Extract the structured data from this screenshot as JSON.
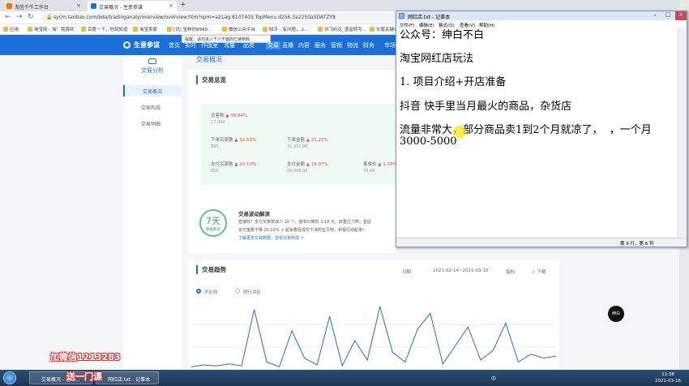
{
  "browser": {
    "tabs": [
      {
        "label": "淘宝千牛工作台"
      },
      {
        "label": "交易概况 - 生意参谋"
      }
    ],
    "new_tab": "+",
    "url": "sycm.taobao.com/bda/tradinganaly/overview/overview.htm?spm=a21ag.8107403.TopMenu.d256.3a2250a5DATZY8",
    "bookmarks": [
      "应用",
      "淘宝网 - 淘！我喜欢",
      "百度一下，你就知道",
      "淘宝卖家",
      "[讯] 宝林你9999...",
      "微信公众平台",
      "知乎 - 有问题，上...",
      "讯飞听见_语音转写...",
      "长尾关键词"
    ]
  },
  "topnav": {
    "brand": "生意参谋",
    "items": [
      "首页",
      "实时",
      "作战室",
      "流量",
      "品类",
      "交易",
      "直播",
      "内容",
      "服务",
      "营销",
      "物流",
      "财务",
      "市场"
    ],
    "active_index": 5,
    "tooltip": "提醒：请勿进入千人千面的已读到我"
  },
  "sidebar": {
    "title": "交易分析",
    "items": [
      "交易概况",
      "交易构成",
      "交易明细"
    ],
    "active_index": 0
  },
  "page_title": "交易概况",
  "overview": {
    "title": "交易总览",
    "metrics": [
      {
        "label": "访客数",
        "change": "38.84%",
        "value": "17,990"
      },
      {
        "label": "下单买家数",
        "change": "32.69%",
        "value": "865"
      },
      {
        "label": "下单金额",
        "change": "21.22%",
        "value": "31,332.06"
      },
      {
        "label": "支付买家数",
        "change": "20.13%",
        "value": "856"
      },
      {
        "label": "支付金额",
        "change": "19.07%",
        "value": "29,008.98"
      },
      {
        "label": "客单价",
        "change": "1.34%",
        "value": "30.40"
      }
    ]
  },
  "diagnosis": {
    "badge_num": "7天",
    "badge_sub": "数据解读",
    "title": "交易波动解读",
    "lines": [
      "直播较！支付买家数减少 10 个，客单价降低 3.18 元，双重压力啊，金店",
      "支付金额下降 20.22% + 起采着看成交下滑的宝贝吧，积极行动起来！",
      "了解更多交易数据，查看交易构成 >"
    ]
  },
  "trend": {
    "title": "交易趋势",
    "period_label": "日期",
    "date_range": "2021-02-14~2021-03-15",
    "indicator_label": "指标",
    "download_label": "下载",
    "radio_1": "不比较",
    "radio_2": "同行对比",
    "line_values": [
      3,
      5,
      4,
      6,
      4,
      62,
      8,
      3,
      40,
      12,
      5,
      55,
      4,
      30,
      10,
      65,
      18,
      8,
      42,
      58,
      6,
      25,
      44,
      10,
      20,
      48,
      8,
      16,
      12,
      14
    ]
  },
  "notepad": {
    "title": "网红店.txt - 记事本",
    "menu": [
      "文件(F)",
      "编辑(E)",
      "格式(O)",
      "查看(V)",
      "帮助(H)"
    ],
    "text": "公众号：绅白不白\n\n淘宝网红店玩法\n\n1. 项目介绍+开店准备\n\n抖音 快手里当月最火的商品，杂货店\n\n流量非常大，部分商品卖1到2个月就凉了，  ，一个月\n3000-5000",
    "status": "第 9 行，第 6 列"
  },
  "taskbar": {
    "apps": [
      "交易概况 - 生意...",
      "网红店.txt - 记事本"
    ],
    "time": "11:38",
    "date": "2021-03-16",
    "tray": "中"
  },
  "overlay": {
    "avatar_text": "绅白",
    "watermark_1": "加微信1213283",
    "watermark_2": "送一门课"
  }
}
